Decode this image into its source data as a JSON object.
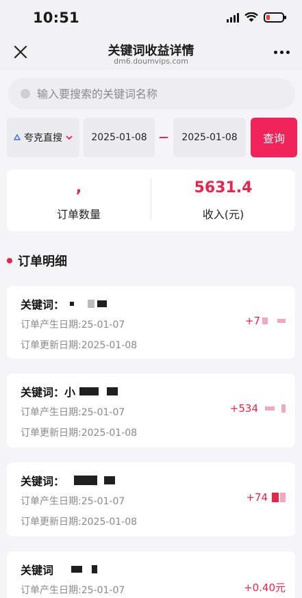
{
  "status": {
    "time": "10:51"
  },
  "nav": {
    "title": "关键词收益详情",
    "subtitle": "dm6.doumvips.com"
  },
  "search": {
    "placeholder": "输入要搜索的关键词名称"
  },
  "filter": {
    "platform": "夸克直搜",
    "start_date": "2025-01-08",
    "end_date": "2025-01-08",
    "query_label": "查询"
  },
  "summary": {
    "orders_value": ",",
    "orders_label": "订单数量",
    "income_value": "5631.4",
    "income_label": "收入(元)"
  },
  "section_title": "订单明细",
  "orders": [
    {
      "keyword_label": "关键词：",
      "keyword": "",
      "created": "订单产生日期:25-01-07",
      "updated": "订单更新日期:2025-01-08",
      "amount": "+7"
    },
    {
      "keyword_label": "关键词：",
      "keyword": "小",
      "created": "订单产生日期:25-01-07",
      "updated": "订单更新日期:2025-01-08",
      "amount": "+534"
    },
    {
      "keyword_label": "关键词：",
      "keyword": "",
      "created": "订单产生日期:25-01-07",
      "updated": "订单更新日期:2025-01-08",
      "amount": "+74"
    },
    {
      "keyword_label": "关键词",
      "keyword": "",
      "created": "订单产生日期:25-01-07",
      "updated": "",
      "amount": "+0.40元"
    }
  ],
  "colors": {
    "accent": "#e8254a",
    "button": "#f0245b"
  }
}
